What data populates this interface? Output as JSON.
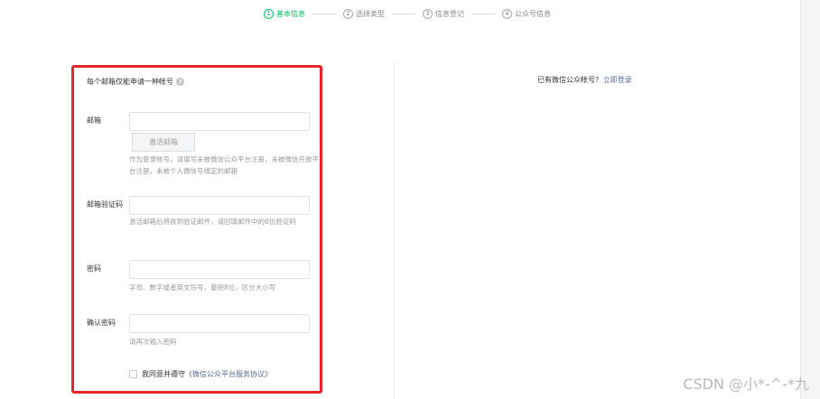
{
  "steps": [
    {
      "num": "1",
      "label": "基本信息",
      "active": true
    },
    {
      "num": "2",
      "label": "选择类型",
      "active": false
    },
    {
      "num": "3",
      "label": "信息登记",
      "active": false
    },
    {
      "num": "4",
      "label": "公众号信息",
      "active": false
    }
  ],
  "form": {
    "notice": "每个邮箱仅能申请一种帐号",
    "email": {
      "label": "邮箱",
      "value": "",
      "activate_button": "激活邮箱",
      "tip": "作为登录帐号，请填写未被微信公众平台注册，未被微信开放平台注册，未被个人微信号绑定的邮箱"
    },
    "code": {
      "label": "邮箱验证码",
      "value": "",
      "tip": "激活邮箱后将收到验证邮件，请回填邮件中的6位验证码"
    },
    "password": {
      "label": "密码",
      "value": "",
      "tip": "字母、数字或者英文符号，最短8位，区分大小写"
    },
    "confirm": {
      "label": "确认密码",
      "value": "",
      "tip": "请再次输入密码"
    },
    "agree": {
      "text": "我同意并遵守",
      "link": "《微信公众平台服务协议》"
    }
  },
  "login_hint": {
    "text": "已有微信公众帐号?",
    "link": "立即登录"
  },
  "watermark": "CSDN @小*-^-*九",
  "colors": {
    "accent_green": "#07c160",
    "highlight_red": "#e5262c",
    "link_blue": "#576b95"
  }
}
